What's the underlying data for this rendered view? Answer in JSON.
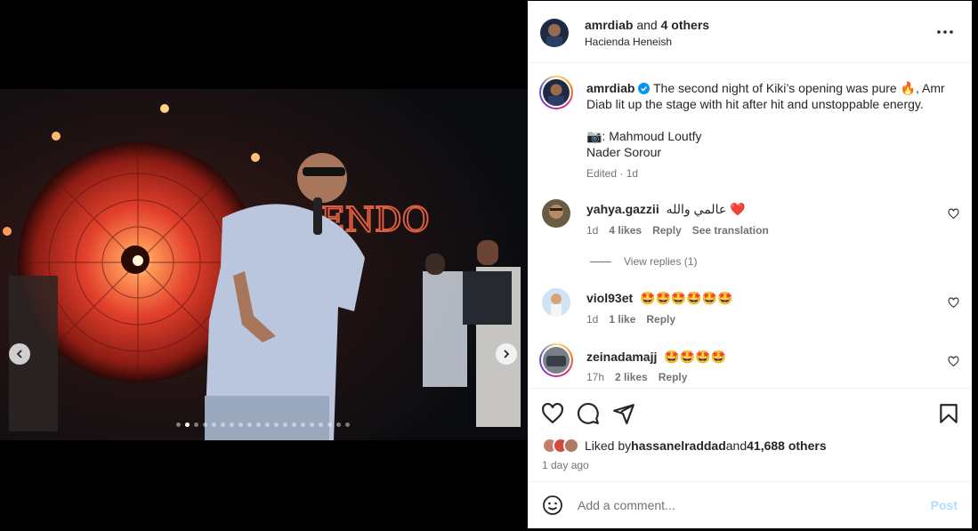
{
  "post": {
    "author": "amrdiab",
    "coauthors": " and ",
    "coauthors_bold": "4 others",
    "location": "Hacienda Heneish",
    "more_icon": "more-horizontal-icon"
  },
  "caption": {
    "username": "amrdiab",
    "line1": "The second night of Kiki’s opening was pure 🔥, Amr Diab lit up the stage with hit after hit and unstoppable energy.",
    "credit1": "📷: Mahmoud Loutfy",
    "credit2": "Nader Sorour",
    "edited": "Edited",
    "time": "1d"
  },
  "comments": [
    {
      "username": "yahya.gazzii",
      "text": "عالمي والله ❤️",
      "time": "1d",
      "likes": "4 likes",
      "reply": "Reply",
      "translate": "See translation",
      "view_replies": "View replies (1)"
    },
    {
      "username": "viol93et",
      "text": "🤩🤩🤩🤩🤩🤩",
      "time": "1d",
      "likes": "1 like",
      "reply": "Reply"
    },
    {
      "username": "zeinadamajj",
      "text": "🤩🤩🤩🤩",
      "time": "17h",
      "likes": "2 likes",
      "reply": "Reply"
    }
  ],
  "likes": {
    "prefix": "Liked by ",
    "user": "hassanelraddad",
    "middle": " and ",
    "others": "41,688 others"
  },
  "time_ago": "1 day ago",
  "compose": {
    "placeholder": "Add a comment...",
    "post_label": "Post"
  },
  "carousel": {
    "total": 20,
    "active": 1
  },
  "colors": {
    "accent_blue": "#0095f6",
    "post_disabled": "#b3dbff",
    "heart_red": "#ff3040",
    "text": "#262626",
    "muted": "#737373"
  }
}
